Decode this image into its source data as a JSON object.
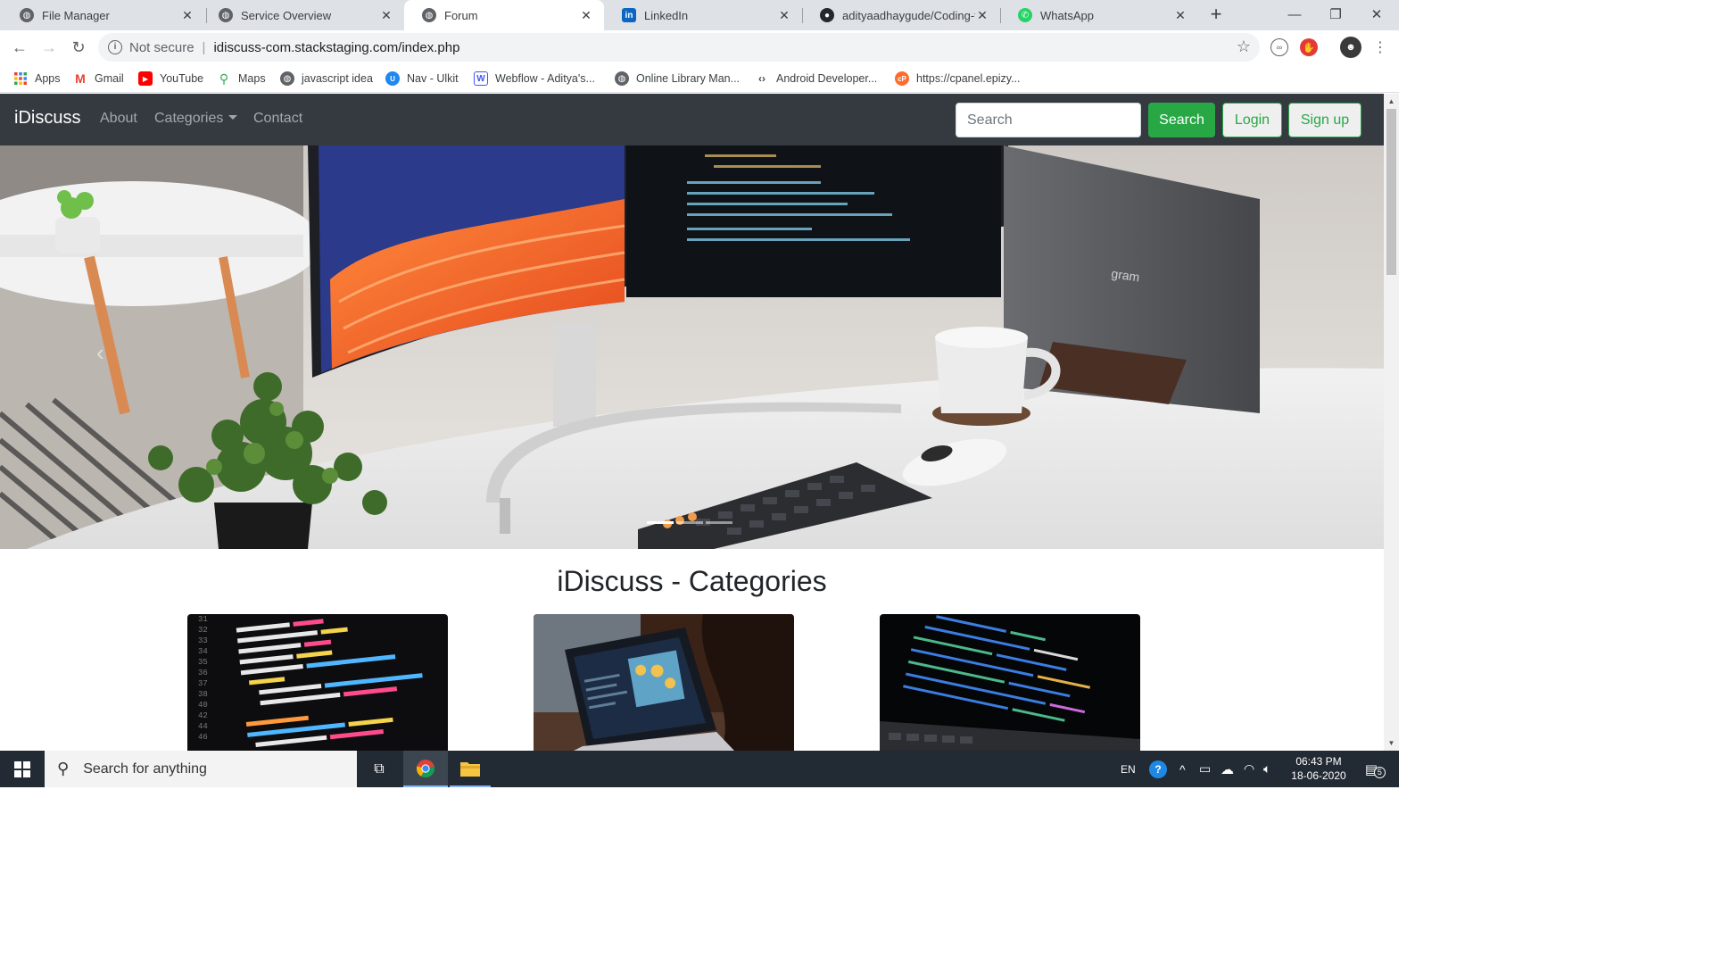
{
  "browser": {
    "tabs": [
      {
        "title": "File Manager",
        "icon": "globe-icon",
        "active": false
      },
      {
        "title": "Service Overview",
        "icon": "globe-icon",
        "active": false
      },
      {
        "title": "Forum",
        "icon": "globe-icon",
        "active": true
      },
      {
        "title": "LinkedIn",
        "icon": "linkedin-icon",
        "active": false
      },
      {
        "title": "adityaadhaygude/Coding-fo",
        "icon": "github-icon",
        "active": false
      },
      {
        "title": "WhatsApp",
        "icon": "whatsapp-icon",
        "active": false
      }
    ],
    "address": {
      "security": "Not secure",
      "url": "idiscuss-com.stackstaging.com/index.php"
    },
    "bookmarks": [
      {
        "label": "Apps",
        "icon": "apps-grid-icon"
      },
      {
        "label": "Gmail",
        "icon": "gmail-icon"
      },
      {
        "label": "YouTube",
        "icon": "youtube-icon"
      },
      {
        "label": "Maps",
        "icon": "maps-icon"
      },
      {
        "label": "javascript idea",
        "icon": "globe-icon"
      },
      {
        "label": "Nav - Ulkit",
        "icon": "ulkit-icon"
      },
      {
        "label": "Webflow - Aditya's...",
        "icon": "webflow-icon"
      },
      {
        "label": "Online Library Man...",
        "icon": "globe-icon"
      },
      {
        "label": "Android Developer...",
        "icon": "code-icon"
      },
      {
        "label": "https://cpanel.epizy...",
        "icon": "cpanel-icon"
      }
    ]
  },
  "site": {
    "brand": "iDiscuss",
    "nav": {
      "about": "About",
      "categories": "Categories",
      "contact": "Contact"
    },
    "search": {
      "placeholder": "Search",
      "button": "Search"
    },
    "login": "Login",
    "signup": "Sign up",
    "categories_title": "iDiscuss - Categories"
  },
  "taskbar": {
    "search_placeholder": "Search for anything",
    "language": "EN",
    "time": "06:43 PM",
    "date": "18-06-2020",
    "notification_count": "5"
  },
  "colors": {
    "navbar": "#343a40",
    "success": "#28a745",
    "chrome_tabstrip": "#dee1e6",
    "taskbar": "#222a33"
  }
}
